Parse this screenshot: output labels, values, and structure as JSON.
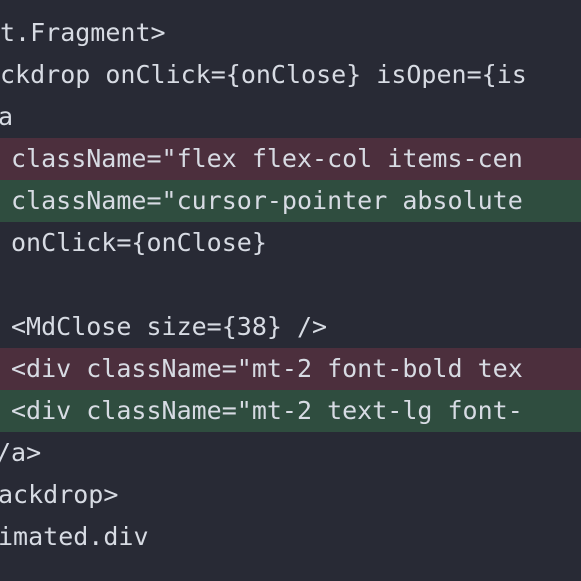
{
  "editor": {
    "lines": [
      {
        "text": "t.Fragment>",
        "type": "context"
      },
      {
        "text": "ckdrop onClick={onClose} isOpen={is",
        "type": "context"
      },
      {
        "text": "a",
        "type": "context"
      },
      {
        "text": "className=\"flex flex-col items-cen",
        "type": "removed"
      },
      {
        "text": "className=\"cursor-pointer absolute",
        "type": "added"
      },
      {
        "text": "onClick={onClose}",
        "type": "context"
      },
      {
        "text": "",
        "type": "context"
      },
      {
        "text": "<MdClose size={38} />",
        "type": "context"
      },
      {
        "text": "<div className=\"mt-2 font-bold tex",
        "type": "removed"
      },
      {
        "text": "<div className=\"mt-2 text-lg font-",
        "type": "added"
      },
      {
        "text": "/a>",
        "type": "context"
      },
      {
        "text": "ackdrop>",
        "type": "context"
      },
      {
        "text": "imated.div",
        "type": "context"
      }
    ],
    "colors": {
      "background": "#282a35",
      "removed_line": "#4c2f3d",
      "added_line": "#2f4d3f",
      "text": "#d7dbe3"
    }
  }
}
